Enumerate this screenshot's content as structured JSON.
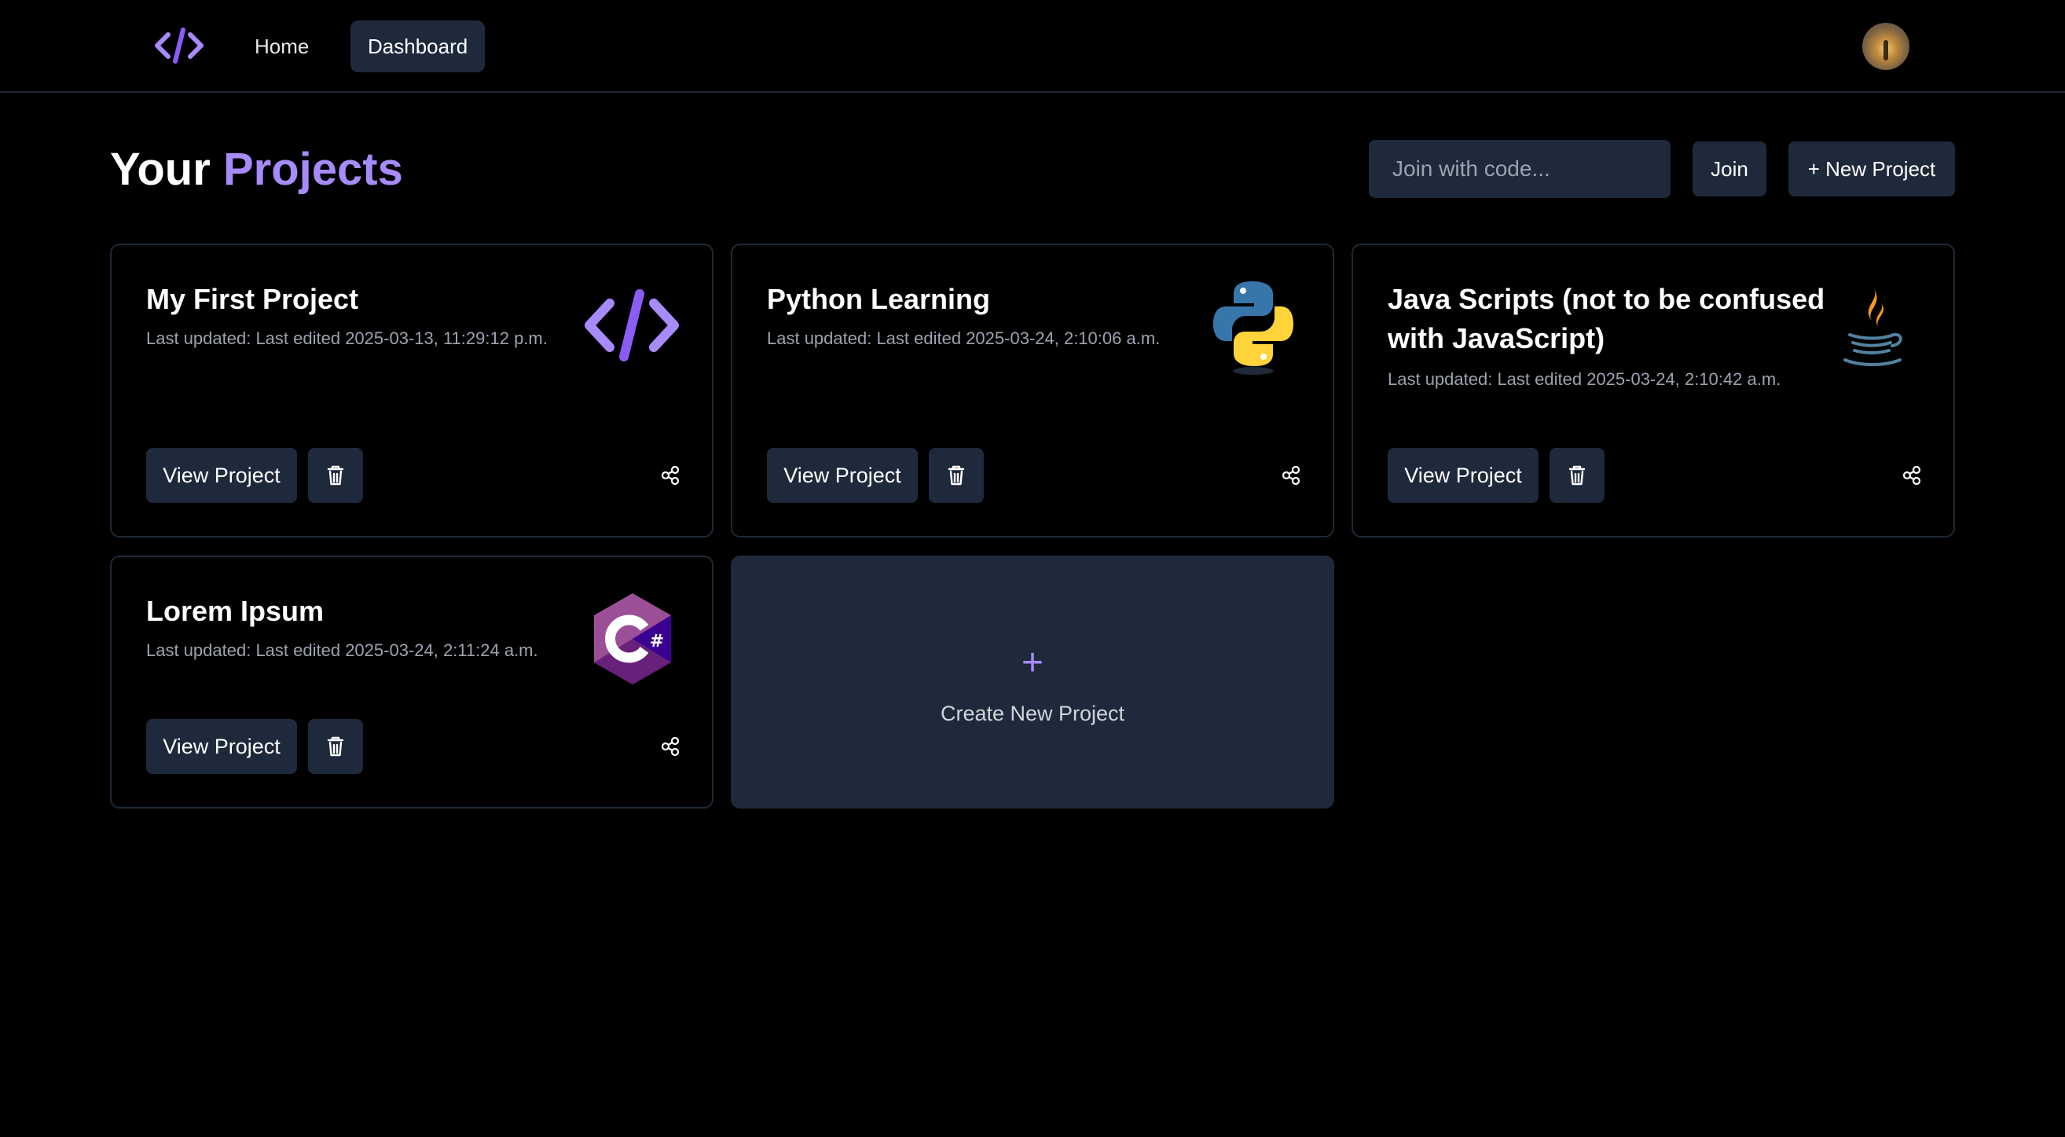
{
  "nav": {
    "logo_icon": "code-brackets-icon",
    "home_label": "Home",
    "dashboard_label": "Dashboard",
    "active": "Dashboard",
    "avatar": "user-avatar"
  },
  "header": {
    "title_part1": "Your",
    "title_part2": "Projects",
    "join_placeholder": "Join with code...",
    "join_label": "Join",
    "new_project_label": "+ New Project"
  },
  "colors": {
    "background": "#000000",
    "surface": "#1e293b",
    "border": "#1f2937",
    "accent": "#a78bfa",
    "muted_text": "#9ca3af"
  },
  "projects": [
    {
      "title": "My First Project",
      "updated": "Last updated: Last edited 2025-03-13, 11:29:12 p.m.",
      "logo": "code-brackets-icon",
      "view_label": "View Project"
    },
    {
      "title": "Python Learning",
      "updated": "Last updated: Last edited 2025-03-24, 2:10:06 a.m.",
      "logo": "python-logo-icon",
      "view_label": "View Project"
    },
    {
      "title": "Java Scripts (not to be confused with JavaScript)",
      "updated": "Last updated: Last edited 2025-03-24, 2:10:42 a.m.",
      "logo": "java-logo-icon",
      "view_label": "View Project"
    },
    {
      "title": "Lorem Ipsum",
      "updated": "Last updated: Last edited 2025-03-24, 2:11:24 a.m.",
      "logo": "csharp-logo-icon",
      "view_label": "View Project"
    }
  ],
  "create_card": {
    "plus": "+",
    "label": "Create New Project"
  }
}
